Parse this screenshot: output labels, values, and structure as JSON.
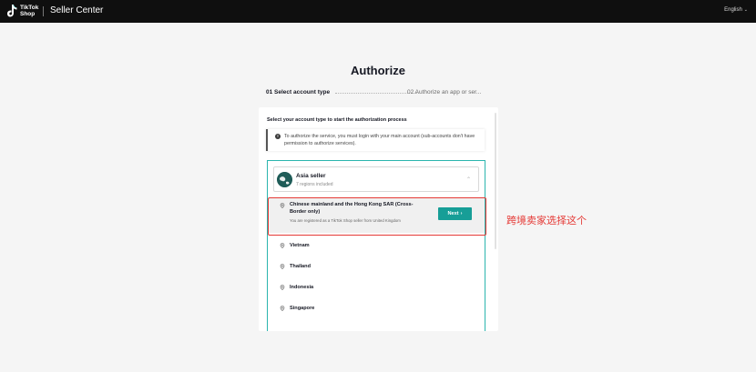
{
  "header": {
    "logo_line1": "TikTok",
    "logo_line2": "Shop",
    "brand": "Seller Center",
    "language": "English",
    "language_icon": "chevron-down-icon"
  },
  "page": {
    "title": "Authorize",
    "steps": [
      {
        "label": "01 Select account type",
        "active": true
      },
      {
        "label": "02 Authorize an app or ser...",
        "active": false
      }
    ],
    "instruction": "Select your account type to start the authorization process",
    "notice": {
      "icon": "info-icon",
      "text": "To authorize the service, you must login with your main account (sub-accounts don't have permission to authorize services)."
    },
    "seller_group": {
      "title": "Asia seller",
      "subtitle": "7 regions included",
      "expanded": true
    },
    "selected_region": {
      "name": "Chinese mainland and the Hong Kong SAR (Cross-Border only)",
      "description": "You are registered as a TikTok Shop seller from United Kingdom",
      "button": "Next"
    },
    "regions": [
      {
        "name": "Vietnam"
      },
      {
        "name": "Thailand"
      },
      {
        "name": "Indonesia"
      },
      {
        "name": "Singapore"
      }
    ]
  },
  "annotation": {
    "text": "跨境卖家选择这个",
    "color": "#e53935"
  },
  "colors": {
    "accent": "#179e97",
    "topbar": "#0f0f0f",
    "highlight": "#e53935"
  }
}
